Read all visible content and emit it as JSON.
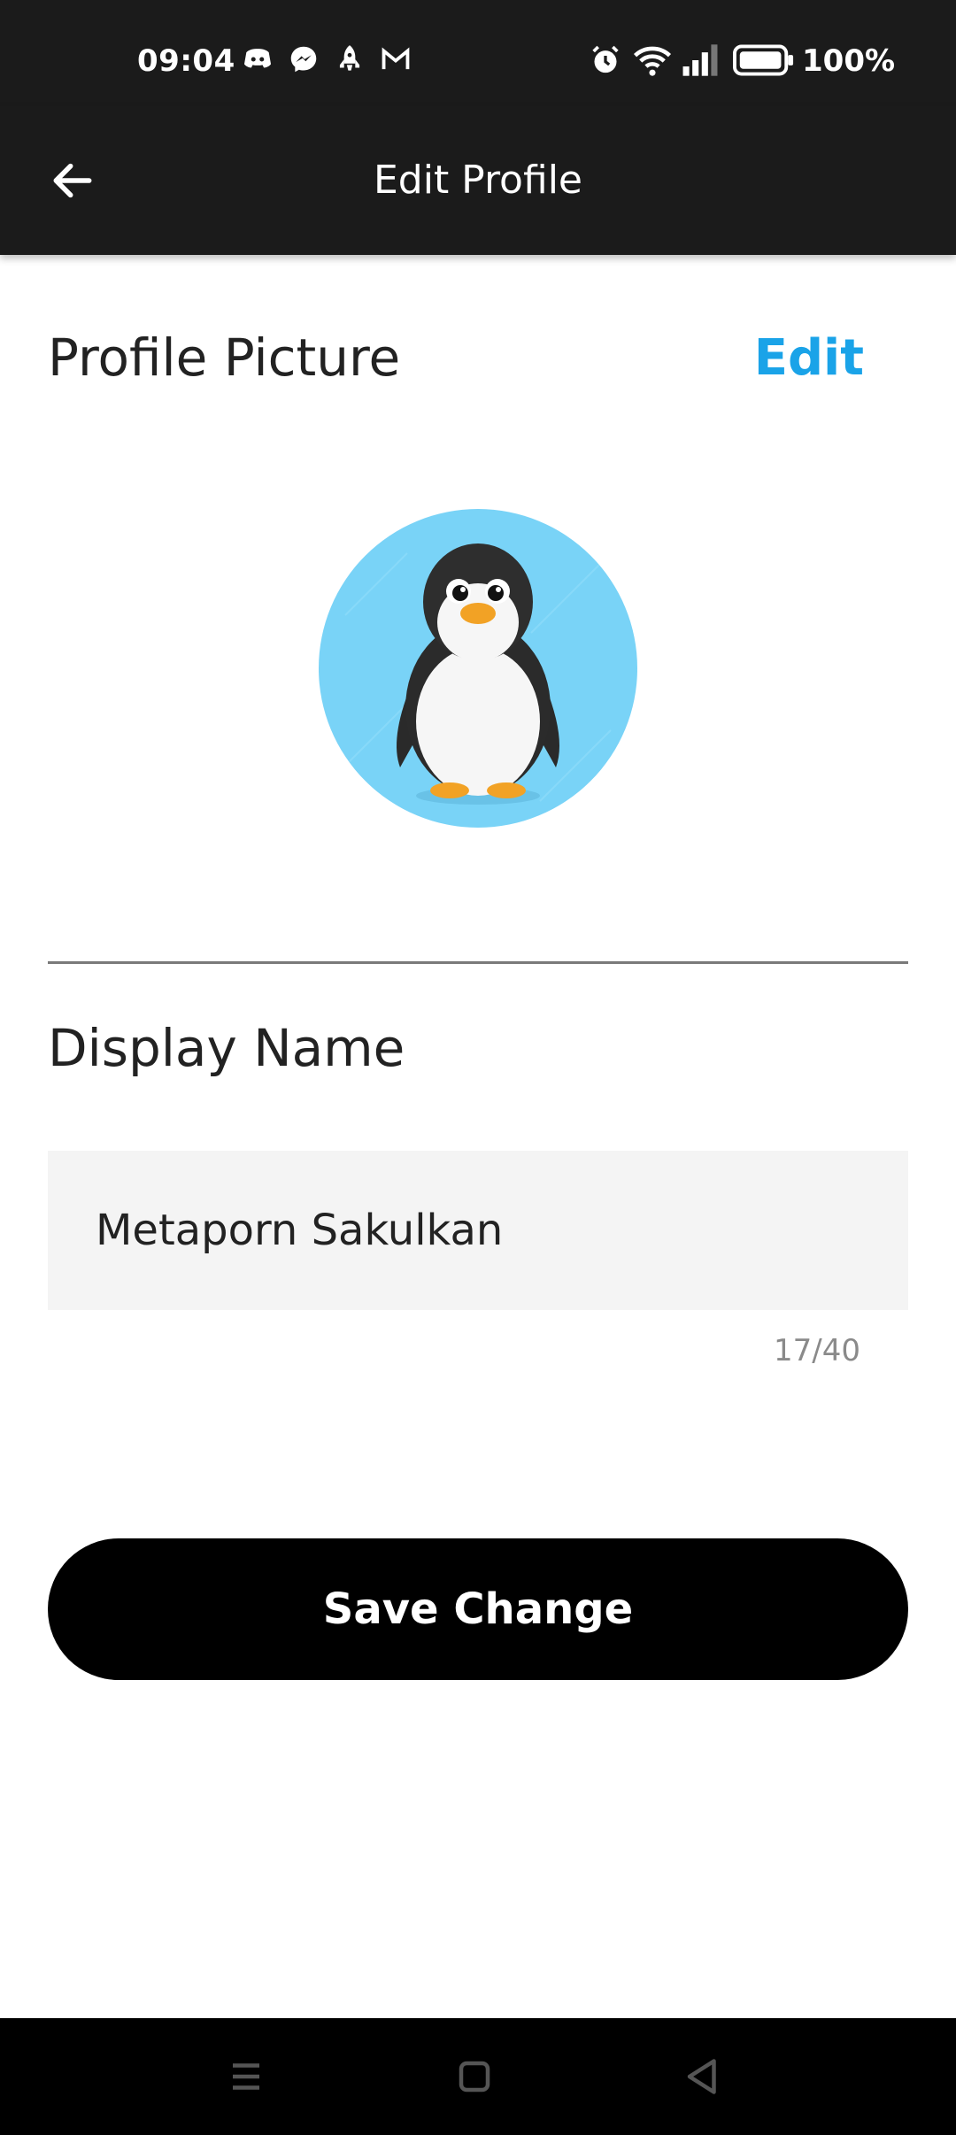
{
  "status_bar": {
    "time": "09:04",
    "notification_icons": [
      "discord-icon",
      "messenger-icon",
      "rocket-icon",
      "gmail-icon"
    ],
    "system_icons": [
      "alarm-icon",
      "wifi-icon",
      "signal-icon",
      "battery-icon"
    ],
    "battery": "100%"
  },
  "app_bar": {
    "title": "Edit Profile",
    "back_icon": "arrow-left-icon"
  },
  "profile_picture": {
    "label": "Profile Picture",
    "edit_label": "Edit",
    "avatar": "penguin-avatar",
    "avatar_bg": "#79d3f7"
  },
  "display_name": {
    "label": "Display Name",
    "value": "Metaporn Sakulkan",
    "counter": "17/40"
  },
  "save_button": {
    "label": "Save Change"
  },
  "colors": {
    "accent": "#1aa3e8",
    "bar": "#1b1b1b",
    "button": "#000000",
    "field_bg": "#f4f4f4"
  },
  "nav_bar": {
    "icons": [
      "recents-icon",
      "home-icon",
      "back-icon"
    ]
  }
}
